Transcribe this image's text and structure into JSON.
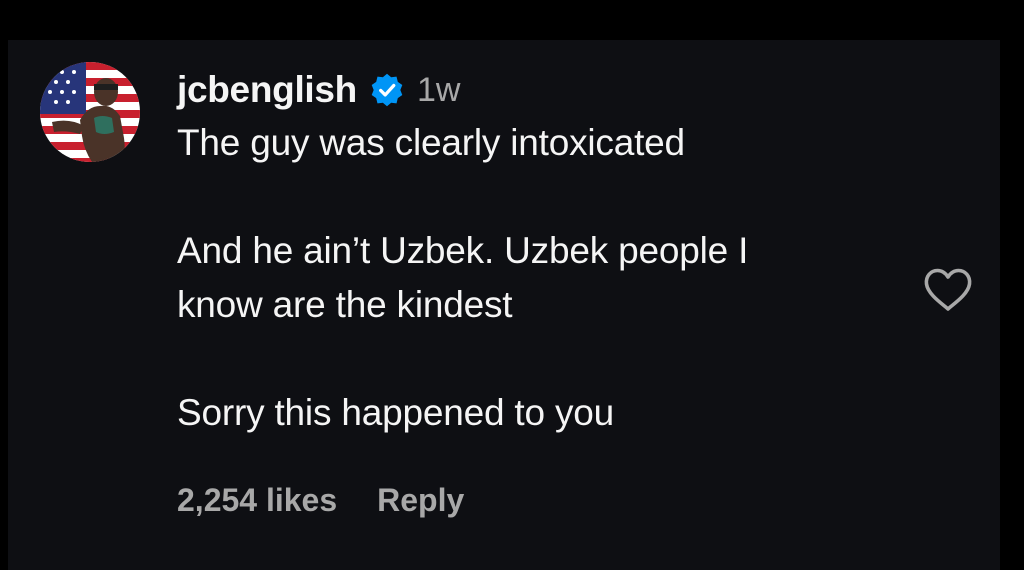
{
  "comment": {
    "username": "jcbenglish",
    "timestamp": "1w",
    "text": "The guy was clearly intoxicated\n\nAnd he ain’t Uzbek. Uzbek people I\nknow are the kindest\n\nSorry this happened to you",
    "likes_label": "2,254 likes",
    "reply_label": "Reply",
    "verified": true
  },
  "icons": {
    "verified": "verified-badge-icon",
    "like": "heart-outline-icon"
  },
  "colors": {
    "background": "#0e0f13",
    "text_primary": "#f5f5f5",
    "text_secondary": "#a8a8a8",
    "verified_blue": "#0095f6"
  }
}
